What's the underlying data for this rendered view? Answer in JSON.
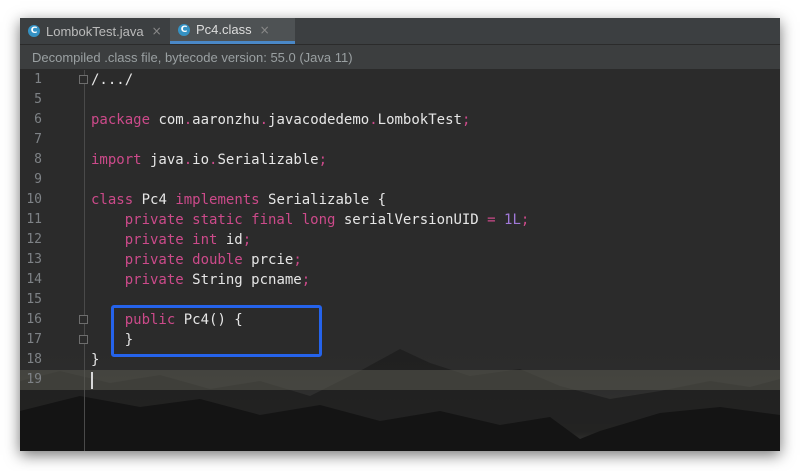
{
  "tabs": [
    {
      "label": "LombokTest.java",
      "close": "×",
      "active": false
    },
    {
      "label": "Pc4.class",
      "close": "×",
      "active": true
    }
  ],
  "banner": "Decompiled .class file, bytecode version: 55.0 (Java 11)",
  "code_lines": [
    {
      "num": "1",
      "tokens": [
        {
          "t": "/.../",
          "c": "plain"
        }
      ]
    },
    {
      "num": "5",
      "tokens": []
    },
    {
      "num": "6",
      "tokens": [
        {
          "t": "package",
          "c": "kw"
        },
        {
          "t": " com",
          "c": "plain"
        },
        {
          "t": ".",
          "c": "op"
        },
        {
          "t": "aaronzhu",
          "c": "plain"
        },
        {
          "t": ".",
          "c": "op"
        },
        {
          "t": "javacodedemo",
          "c": "plain"
        },
        {
          "t": ".",
          "c": "op"
        },
        {
          "t": "LombokTest",
          "c": "plain"
        },
        {
          "t": ";",
          "c": "op"
        }
      ]
    },
    {
      "num": "7",
      "tokens": []
    },
    {
      "num": "8",
      "tokens": [
        {
          "t": "import",
          "c": "kw"
        },
        {
          "t": " java",
          "c": "plain"
        },
        {
          "t": ".",
          "c": "op"
        },
        {
          "t": "io",
          "c": "plain"
        },
        {
          "t": ".",
          "c": "op"
        },
        {
          "t": "Serializable",
          "c": "plain"
        },
        {
          "t": ";",
          "c": "op"
        }
      ]
    },
    {
      "num": "9",
      "tokens": []
    },
    {
      "num": "10",
      "tokens": [
        {
          "t": "class",
          "c": "kw"
        },
        {
          "t": " Pc4 ",
          "c": "plain"
        },
        {
          "t": "implements",
          "c": "kw"
        },
        {
          "t": " Serializable {",
          "c": "plain"
        }
      ]
    },
    {
      "num": "11",
      "tokens": [
        {
          "t": "    ",
          "c": "plain"
        },
        {
          "t": "private static final long",
          "c": "kw"
        },
        {
          "t": " serialVersionUID ",
          "c": "plain"
        },
        {
          "t": "=",
          "c": "op"
        },
        {
          "t": " ",
          "c": "plain"
        },
        {
          "t": "1L",
          "c": "num"
        },
        {
          "t": ";",
          "c": "op"
        }
      ]
    },
    {
      "num": "12",
      "tokens": [
        {
          "t": "    ",
          "c": "plain"
        },
        {
          "t": "private int",
          "c": "kw"
        },
        {
          "t": " id",
          "c": "plain"
        },
        {
          "t": ";",
          "c": "op"
        }
      ]
    },
    {
      "num": "13",
      "tokens": [
        {
          "t": "    ",
          "c": "plain"
        },
        {
          "t": "private double",
          "c": "kw"
        },
        {
          "t": " prcie",
          "c": "plain"
        },
        {
          "t": ";",
          "c": "op"
        }
      ]
    },
    {
      "num": "14",
      "tokens": [
        {
          "t": "    ",
          "c": "plain"
        },
        {
          "t": "private",
          "c": "kw"
        },
        {
          "t": " String pcname",
          "c": "plain"
        },
        {
          "t": ";",
          "c": "op"
        }
      ]
    },
    {
      "num": "15",
      "tokens": []
    },
    {
      "num": "16",
      "tokens": [
        {
          "t": "    ",
          "c": "plain"
        },
        {
          "t": "public",
          "c": "kw"
        },
        {
          "t": " Pc4() {",
          "c": "plain"
        }
      ]
    },
    {
      "num": "17",
      "tokens": [
        {
          "t": "    }",
          "c": "plain"
        }
      ]
    },
    {
      "num": "18",
      "tokens": [
        {
          "t": "}",
          "c": "plain"
        }
      ]
    },
    {
      "num": "19",
      "tokens": []
    }
  ],
  "colors": {
    "keyword": "#cc4a8a",
    "number": "#a078d8",
    "text": "#e6e6e6",
    "highlight_box": "#2563eb",
    "tab_underline": "#4a88c7"
  },
  "icons": {
    "tab_icon": "java-class-icon",
    "tab_icon_glyph": "C"
  }
}
